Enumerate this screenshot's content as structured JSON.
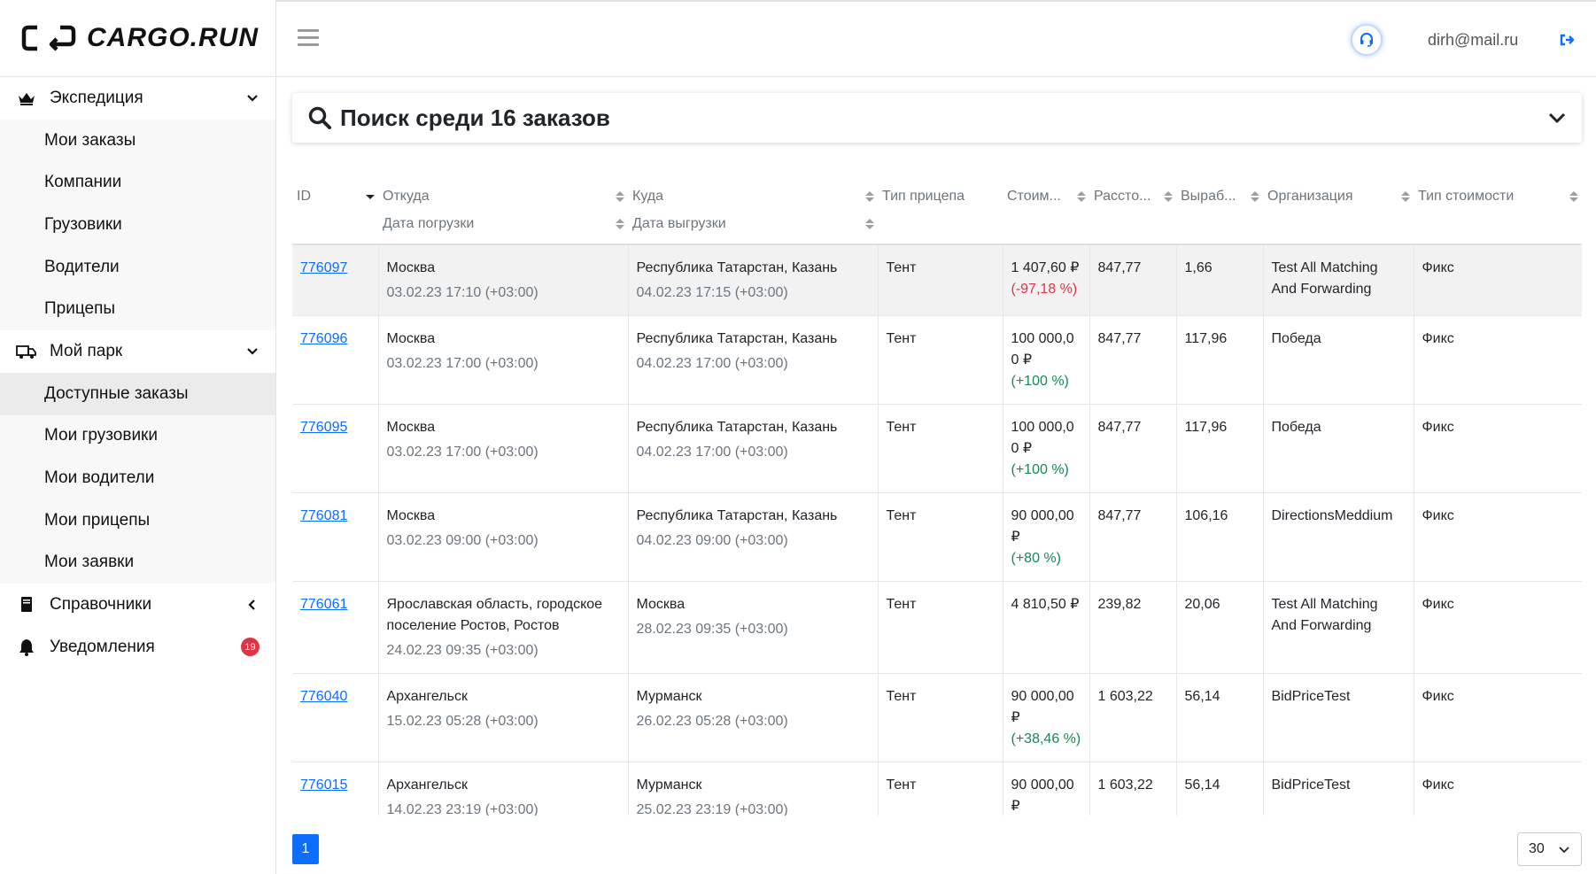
{
  "app": {
    "logo_text": "CARGO.RUN"
  },
  "header": {
    "user_email": "dirh@mail.ru"
  },
  "sidebar": {
    "groups": [
      {
        "label": "Экспедиция",
        "icon": "crown-icon",
        "items": [
          "Мои заказы",
          "Компании",
          "Грузовики",
          "Водители",
          "Прицепы"
        ]
      },
      {
        "label": "Мой парк",
        "icon": "truck-icon",
        "items": [
          "Доступные заказы",
          "Мои грузовики",
          "Мои водители",
          "Мои прицепы",
          "Мои заявки"
        ],
        "active_item": "Доступные заказы"
      },
      {
        "label": "Справочники",
        "icon": "book-icon"
      },
      {
        "label": "Уведомления",
        "icon": "bell-icon",
        "badge": "19"
      }
    ]
  },
  "search": {
    "title": "Поиск среди 16 заказов"
  },
  "table": {
    "headers": {
      "id": "ID",
      "from": "Откуда",
      "load_date": "Дата погрузки",
      "to": "Куда",
      "unload_date": "Дата выгрузки",
      "trailer": "Тип прицепа",
      "cost": "Стоим...",
      "distance": "Рассто...",
      "output": "Выраб...",
      "org": "Организация",
      "cost_type": "Тип стоимости"
    },
    "rows": [
      {
        "id": "776097",
        "from": "Москва",
        "load_date": "03.02.23 17:10 (+03:00)",
        "to": "Республика Татарстан, Казань",
        "unload_date": "04.02.23 17:15 (+03:00)",
        "trailer": "Тент",
        "cost": "1 407,60 ₽",
        "delta": "(-97,18 %)",
        "delta_sign": "neg",
        "distance": "847,77",
        "output": "1,66",
        "org": "Test All Matching And Forwarding",
        "cost_type": "Фикс"
      },
      {
        "id": "776096",
        "from": "Москва",
        "load_date": "03.02.23 17:00 (+03:00)",
        "to": "Республика Татарстан, Казань",
        "unload_date": "04.02.23 17:00 (+03:00)",
        "trailer": "Тент",
        "cost": "100 000,0 0 ₽",
        "delta": "(+100 %)",
        "delta_sign": "pos",
        "distance": "847,77",
        "output": "117,96",
        "org": "Победа",
        "cost_type": "Фикс"
      },
      {
        "id": "776095",
        "from": "Москва",
        "load_date": "03.02.23 17:00 (+03:00)",
        "to": "Республика Татарстан, Казань",
        "unload_date": "04.02.23 17:00 (+03:00)",
        "trailer": "Тент",
        "cost": "100 000,0 0 ₽",
        "delta": "(+100 %)",
        "delta_sign": "pos",
        "distance": "847,77",
        "output": "117,96",
        "org": "Победа",
        "cost_type": "Фикс"
      },
      {
        "id": "776081",
        "from": "Москва",
        "load_date": "03.02.23 09:00 (+03:00)",
        "to": "Республика Татарстан, Казань",
        "unload_date": "04.02.23 09:00 (+03:00)",
        "trailer": "Тент",
        "cost": "90 000,00 ₽",
        "delta": "(+80 %)",
        "delta_sign": "pos",
        "distance": "847,77",
        "output": "106,16",
        "org": "DirectionsMeddium",
        "cost_type": "Фикс"
      },
      {
        "id": "776061",
        "from": "Ярославская область, городское поселение Ростов, Ростов",
        "load_date": "24.02.23 09:35 (+03:00)",
        "to": "Москва",
        "unload_date": "28.02.23 09:35 (+03:00)",
        "trailer": "Тент",
        "cost": "4 810,50 ₽",
        "delta": "",
        "delta_sign": "",
        "distance": "239,82",
        "output": "20,06",
        "org": "Test All Matching And Forwarding",
        "cost_type": "Фикс"
      },
      {
        "id": "776040",
        "from": "Архангельск",
        "load_date": "15.02.23 05:28 (+03:00)",
        "to": "Мурманск",
        "unload_date": "26.02.23 05:28 (+03:00)",
        "trailer": "Тент",
        "cost": "90 000,00 ₽",
        "delta": "(+38,46 %)",
        "delta_sign": "pos",
        "distance": "1 603,22",
        "output": "56,14",
        "org": "BidPriceTest",
        "cost_type": "Фикс"
      },
      {
        "id": "776015",
        "from": "Архангельск",
        "load_date": "14.02.23 23:19 (+03:00)",
        "to": "Мурманск",
        "unload_date": "25.02.23 23:19 (+03:00)",
        "trailer": "Тент",
        "cost": "90 000,00 ₽",
        "delta": "",
        "delta_sign": "",
        "distance": "1 603,22",
        "output": "56,14",
        "org": "BidPriceTest",
        "cost_type": "Фикс"
      }
    ]
  },
  "pagination": {
    "current_page": "1",
    "page_size": "30"
  }
}
